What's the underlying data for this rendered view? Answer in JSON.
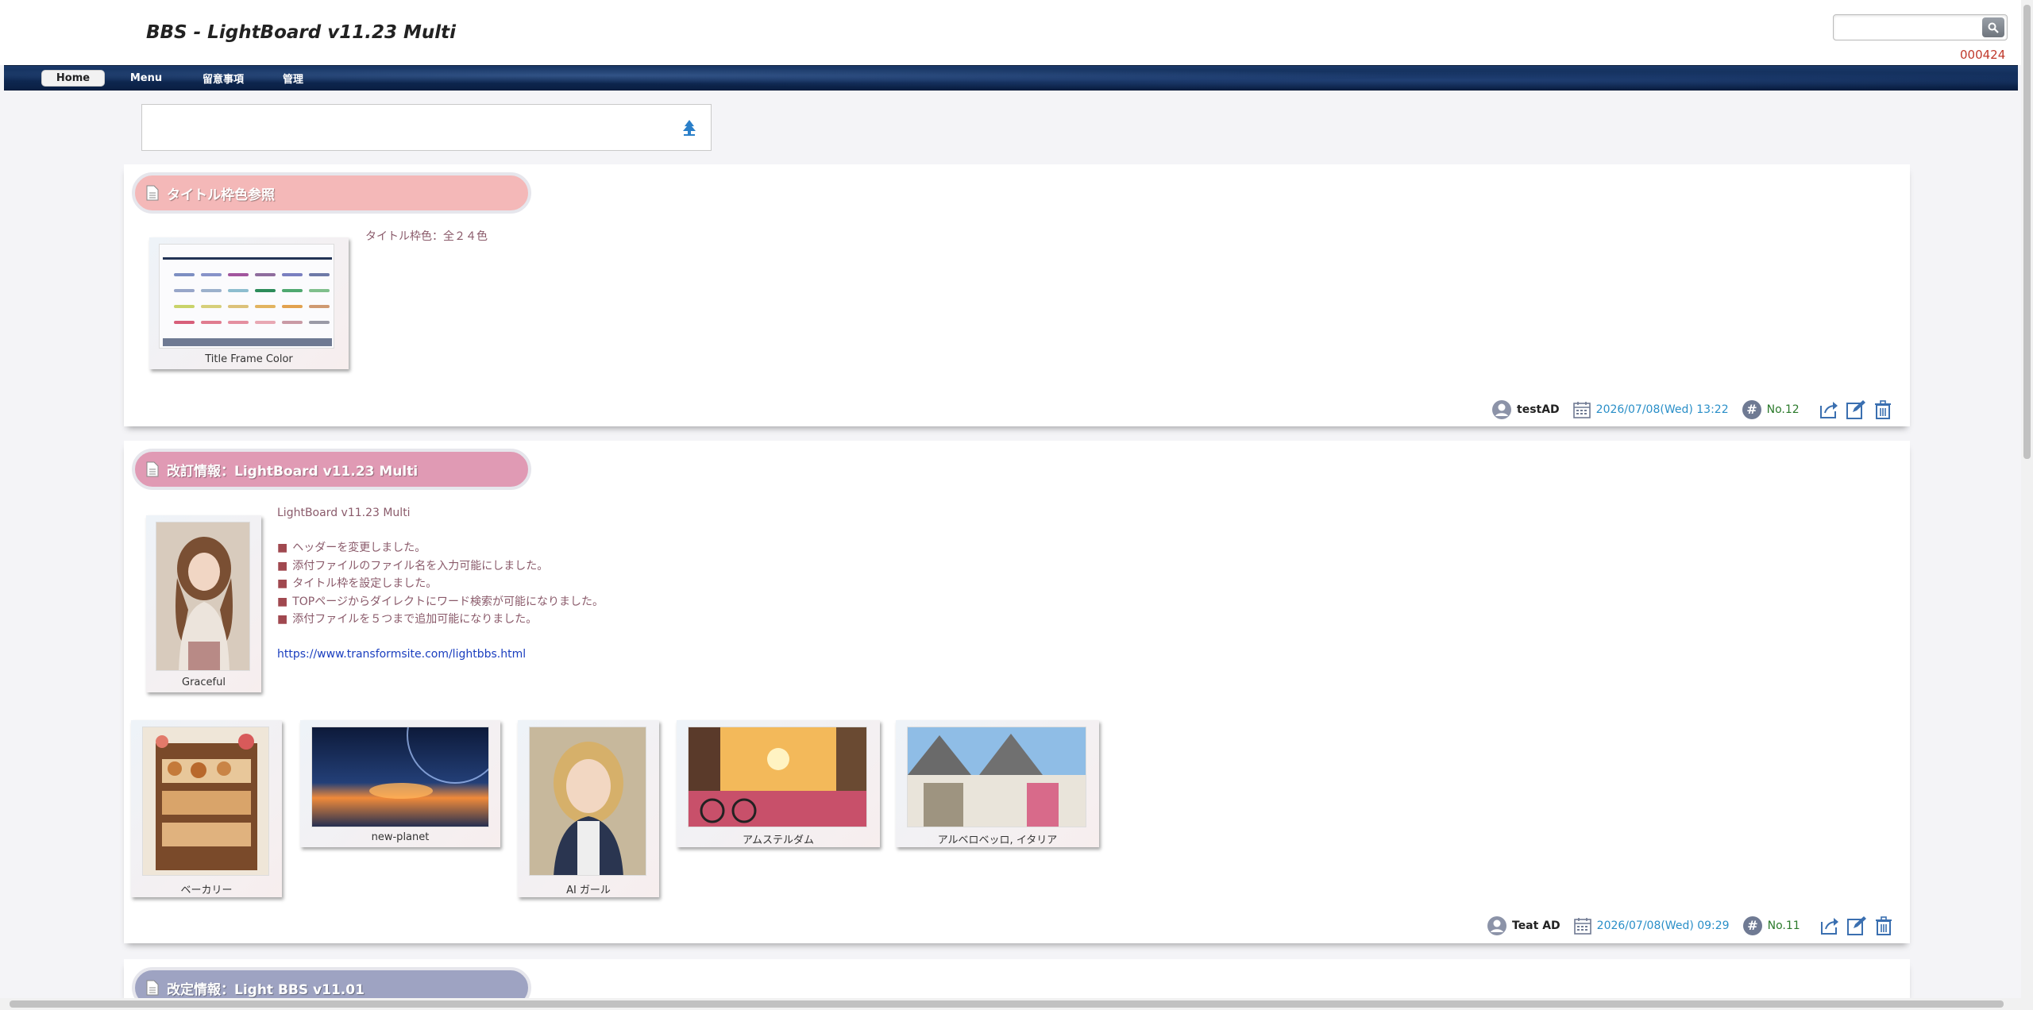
{
  "header": {
    "title": "BBS - LightBoard v11.23 Multi",
    "search_placeholder": "",
    "counter": "000424"
  },
  "nav": {
    "items": [
      "Home",
      "Menu",
      "留意事項",
      "管理"
    ]
  },
  "posts": [
    {
      "title": "タイトル枠色参照",
      "title_color": "#f4b8b8",
      "thumbnail_caption": "Title Frame Color",
      "body": "タイトル枠色：全２４色",
      "user": "testAD",
      "date": "2026/07/08(Wed) 13:22",
      "no": "No.12"
    },
    {
      "title": "改訂情報：LightBoard v11.23 Multi",
      "title_color": "#e09ab4",
      "thumbnail_caption": "Graceful",
      "body_heading": "LightBoard v11.23 Multi",
      "bullets": [
        "ヘッダーを変更しました。",
        "添付ファイルのファイル名を入力可能にしました。",
        "タイトル枠を設定しました。",
        "TOPページからダイレクトにワード検索が可能になりました。",
        "添付ファイルを５つまで追加可能になりました。"
      ],
      "link": "https://www.transformsite.com/lightbbs.html",
      "attachments": [
        "ベーカリー",
        "new-planet",
        "AI ガール",
        "アムステルダム",
        "アルベロベッロ, イタリア"
      ],
      "user": "Teat AD",
      "date": "2026/07/08(Wed) 09:29",
      "no": "No.11"
    },
    {
      "title": "改定情報：Light BBS v11.01",
      "title_color": "#9ea3c2"
    }
  ],
  "icons": {
    "search": "search-icon",
    "document": "document-icon",
    "user": "user-icon",
    "calendar": "calendar-icon",
    "hash": "hash-icon",
    "share": "share-icon",
    "edit": "edit-icon",
    "trash": "trash-icon",
    "tree": "tree-icon"
  }
}
